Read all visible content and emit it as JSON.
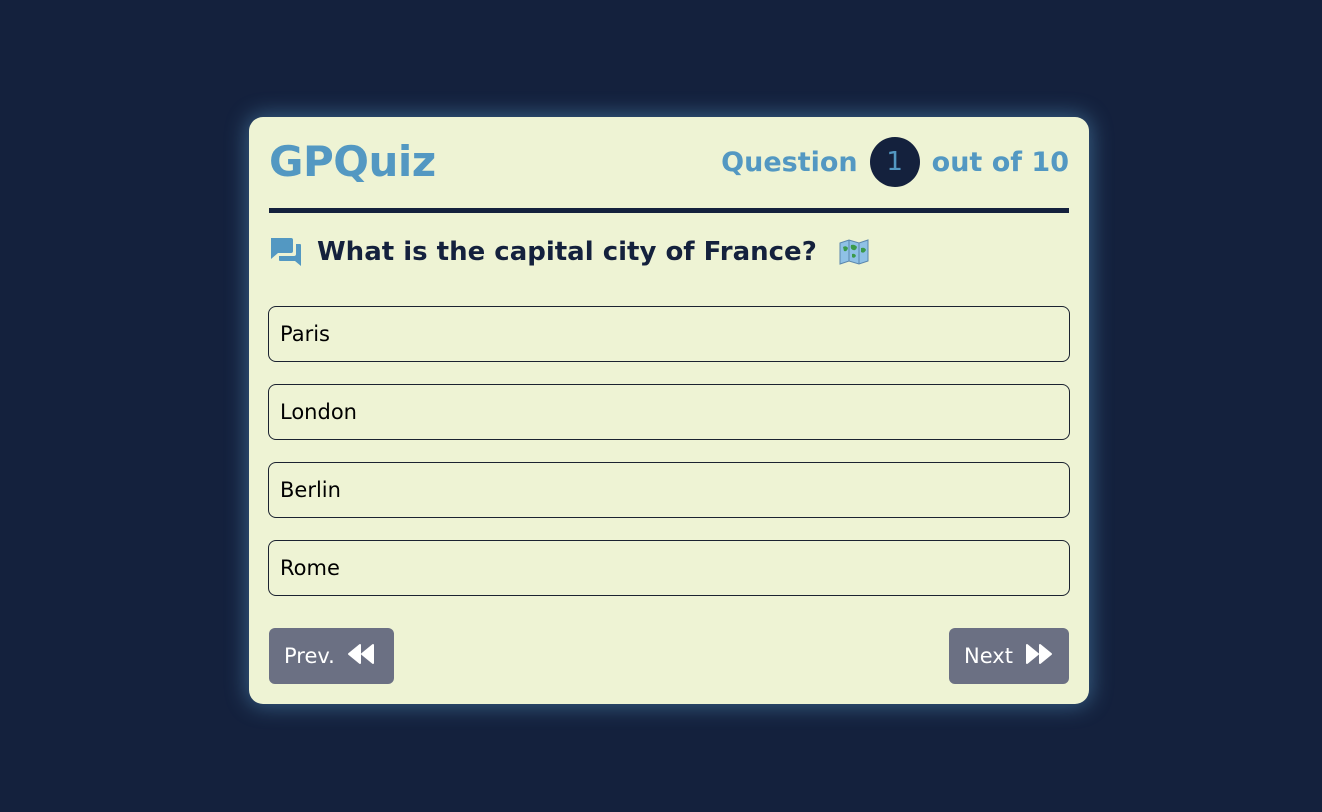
{
  "app": {
    "title": "GPQuiz"
  },
  "counter": {
    "prefix": "Question",
    "current": "1",
    "suffix": "out of 10"
  },
  "question": {
    "text": "What is the capital city of France?",
    "icon": "chat-bubbles-icon",
    "emoji_icon": "world-map-icon"
  },
  "options": [
    {
      "label": "Paris"
    },
    {
      "label": "London"
    },
    {
      "label": "Berlin"
    },
    {
      "label": "Rome"
    }
  ],
  "nav": {
    "prev_label": "Prev.",
    "next_label": "Next",
    "prev_icon": "rewind-icon",
    "next_icon": "fast-forward-icon"
  },
  "colors": {
    "background": "#14213d",
    "card": "#eef3d4",
    "accent": "#5398c2",
    "button": "#6b7083"
  }
}
